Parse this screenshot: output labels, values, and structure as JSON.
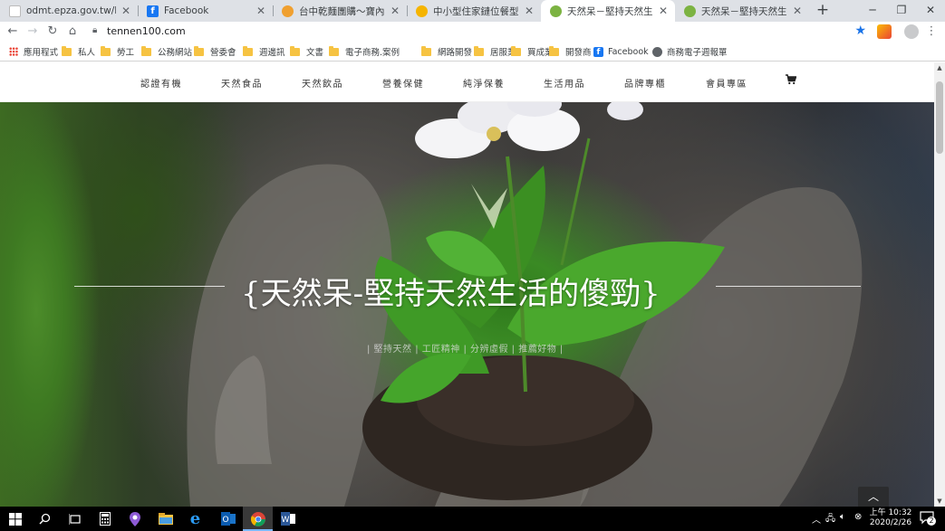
{
  "browser": {
    "tabs": [
      {
        "title": "odmt.epza.gov.tw/FolderLis",
        "icon": "page-icon",
        "active": false
      },
      {
        "title": "Facebook",
        "icon": "facebook-icon",
        "active": false
      },
      {
        "title": "台中乾麵團購～寶內專業名合",
        "icon": "site-icon",
        "active": false
      },
      {
        "title": "中小型住家鏈位餐型週設網",
        "icon": "site-icon",
        "active": false
      },
      {
        "title": "天然呆－堅持天然生活的傻勁",
        "icon": "tennen-icon",
        "active": true
      },
      {
        "title": "天然呆－堅持天然生活的傻勁",
        "icon": "tennen-icon",
        "active": false
      }
    ],
    "new_tab_label": "+",
    "url": "tennen100.com",
    "bookmarks": [
      {
        "label": "應用程式",
        "icon": "apps-icon"
      },
      {
        "label": "私人",
        "icon": "folder-icon"
      },
      {
        "label": "勞工",
        "icon": "folder-icon"
      },
      {
        "label": "公務網站",
        "icon": "folder-icon"
      },
      {
        "label": "營委會",
        "icon": "folder-icon"
      },
      {
        "label": "週邊訊",
        "icon": "folder-icon"
      },
      {
        "label": "文書",
        "icon": "folder-icon"
      },
      {
        "label": "電子商務.案例",
        "icon": "folder-icon"
      },
      {
        "label": "網路開發",
        "icon": "folder-icon"
      },
      {
        "label": "居服業",
        "icon": "folder-icon"
      },
      {
        "label": "買成業",
        "icon": "folder-icon"
      },
      {
        "label": "開發商",
        "icon": "folder-icon"
      },
      {
        "label": "Facebook",
        "icon": "facebook-icon"
      },
      {
        "label": "商務電子週報單",
        "icon": "globe-icon"
      }
    ]
  },
  "site": {
    "nav": [
      "認證有機",
      "天然食品",
      "天然飲品",
      "營養保健",
      "純淨保養",
      "生活用品",
      "品牌專櫃",
      "會員專區"
    ],
    "cart_icon": "cart-icon",
    "hero_title": "{天然呆-堅持天然生活的傻勁}",
    "hero_subtitle": "| 堅持天然 | 工匠精神 | 分辨虛假 | 推薦好物 |",
    "back_to_top_icon": "chevron-up-icon"
  },
  "taskbar": {
    "clock_time": "上午 10:32",
    "clock_date": "2020/2/26",
    "notification_count": "2"
  },
  "colors": {
    "tab_strip": "#dee1e6",
    "accent_blue": "#1a73e8",
    "taskbar": "#000000"
  }
}
